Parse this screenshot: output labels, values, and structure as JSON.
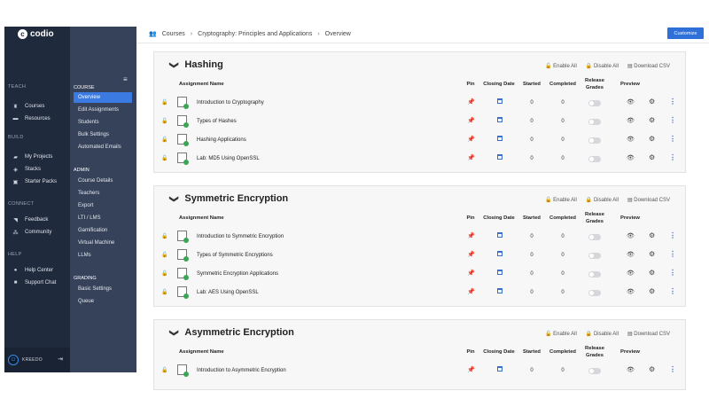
{
  "brand": {
    "logo_letter": "c",
    "name": "codio"
  },
  "nav": {
    "sections": [
      {
        "label": "TEACH",
        "items": [
          {
            "label": "Courses",
            "icon": "graduation-cap-icon",
            "glyph": "♜"
          },
          {
            "label": "Resources",
            "icon": "folder-icon",
            "glyph": "▬"
          }
        ]
      },
      {
        "label": "BUILD",
        "items": [
          {
            "label": "My Projects",
            "icon": "code-icon",
            "glyph": "▰"
          },
          {
            "label": "Stacks",
            "icon": "stack-icon",
            "glyph": "◈"
          },
          {
            "label": "Starter Packs",
            "icon": "box-icon",
            "glyph": "▣"
          }
        ]
      },
      {
        "label": "CONNECT",
        "items": [
          {
            "label": "Feedback",
            "icon": "megaphone-icon",
            "glyph": "◥"
          },
          {
            "label": "Community",
            "icon": "community-icon",
            "glyph": "⁂"
          }
        ]
      },
      {
        "label": "HELP",
        "items": [
          {
            "label": "Help Center",
            "icon": "question-icon",
            "glyph": "●"
          },
          {
            "label": "Support Chat",
            "icon": "chat-icon",
            "glyph": "■"
          }
        ]
      }
    ],
    "user": {
      "name": "KREEDO"
    }
  },
  "course_nav": {
    "sections": [
      {
        "label": "COURSE",
        "items": [
          "Overview",
          "Edit Assignments",
          "Students",
          "Bulk Settings",
          "Automated Emails"
        ]
      },
      {
        "label": "ADMIN",
        "items": [
          "Course Details",
          "Teachers",
          "Export",
          "LTI / LMS",
          "Gamification",
          "Virtual Machine",
          "LLMs"
        ]
      },
      {
        "label": "GRADING",
        "items": [
          "Basic Settings",
          "Queue"
        ]
      }
    ],
    "active": "Overview"
  },
  "breadcrumb": [
    "Courses",
    "Cryptography: Principles and Applications",
    "Overview"
  ],
  "customize_label": "Customize",
  "panel_actions": {
    "enable_all": "Enable All",
    "disable_all": "Disable All",
    "download_csv": "Download CSV"
  },
  "columns": {
    "name": "Assignment Name",
    "pin": "Pin",
    "closing": "Closing Date",
    "started": "Started",
    "completed": "Completed",
    "release1": "Release",
    "release2": "Grades",
    "preview": "Preview"
  },
  "modules": [
    {
      "title": "Hashing",
      "assignments": [
        {
          "name": "Introduction to Cryptography",
          "started": "0",
          "completed": "0"
        },
        {
          "name": "Types of Hashes",
          "started": "0",
          "completed": "0"
        },
        {
          "name": "Hashing Applications",
          "started": "0",
          "completed": "0"
        },
        {
          "name": "Lab: MD5 Using OpenSSL",
          "started": "0",
          "completed": "0"
        }
      ]
    },
    {
      "title": "Symmetric Encryption",
      "assignments": [
        {
          "name": "Introduction to Symmetric Encryption",
          "started": "0",
          "completed": "0"
        },
        {
          "name": "Types of Symmetric Encryptions",
          "started": "0",
          "completed": "0"
        },
        {
          "name": "Symmetric Encryption Applications",
          "started": "0",
          "completed": "0"
        },
        {
          "name": "Lab: AES Using OpenSSL",
          "started": "0",
          "completed": "0"
        }
      ]
    },
    {
      "title": "Asymmetric Encryption",
      "assignments": [
        {
          "name": "Introduction to Asymmetric Encryption",
          "started": "0",
          "completed": "0"
        }
      ]
    }
  ]
}
